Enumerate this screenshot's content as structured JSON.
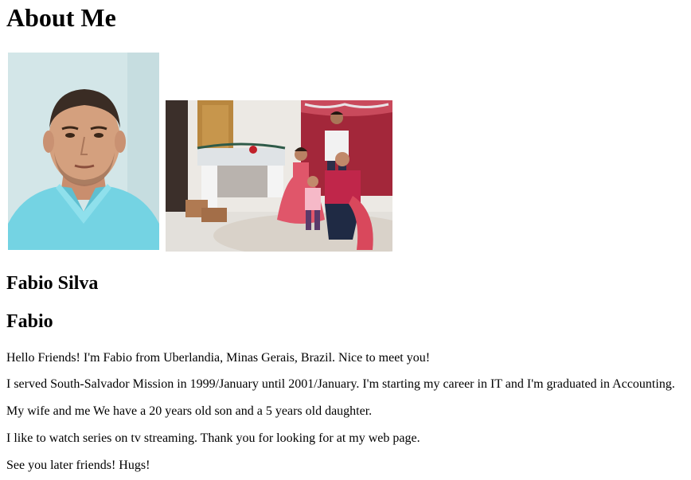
{
  "page": {
    "title": "About Me"
  },
  "profile": {
    "full_name": "Fabio Silva",
    "short_name": "Fabio"
  },
  "paragraphs": [
    "Hello Friends! I'm Fabio from Uberlandia, Minas Gerais, Brazil. Nice to meet you!",
    "I served South-Salvador Mission in 1999/January until 2001/January. I'm starting my career in IT and I'm graduated in Accounting.",
    "My wife and me We have a 20 years old son and a 5 years old daughter.",
    "I like to watch series on tv streaming. Thank you for looking for at my web page.",
    "See you later friends! Hugs!"
  ],
  "colors": {
    "portrait_bg": "#cfe3e6",
    "shirt": "#6fd0e0",
    "curtain": "#a3273a",
    "dress": "#e0566a"
  }
}
